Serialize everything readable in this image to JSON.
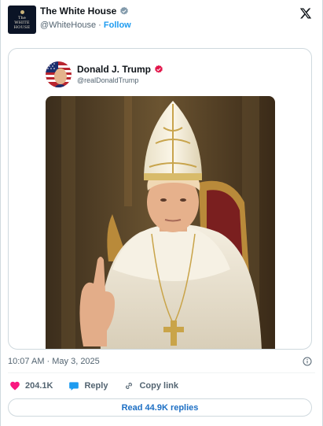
{
  "post": {
    "author_name": "The White House",
    "author_handle": "@WhiteHouse",
    "separator": "·",
    "follow_label": "Follow",
    "avatar_text": [
      "The",
      "WHITE",
      "HOUSE"
    ],
    "timestamp": "10:07 AM · May 3, 2025"
  },
  "quoted": {
    "author_name": "Donald J. Trump",
    "author_handle": "@realDonaldTrump",
    "image_icon": "photo"
  },
  "actions": {
    "like_count": "204.1K",
    "reply_label": "Reply",
    "copy_link_label": "Copy link",
    "read_replies_label": "Read 44.9K replies"
  },
  "colors": {
    "verified_blue": "#1d9bf0",
    "verified_gold_red": "#e2154a",
    "like_pink": "#f91880",
    "link_blue": "#1d6fc4"
  }
}
